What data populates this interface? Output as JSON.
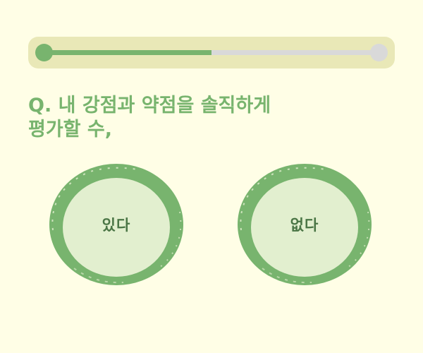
{
  "progress": {
    "fraction": 0.5
  },
  "question": {
    "lines": [
      "Q. 내 강점과 약점을 솔직하게",
      "평가할 수,"
    ]
  },
  "answers": [
    {
      "label": "있다"
    },
    {
      "label": "없다"
    }
  ],
  "colors": {
    "background": "#fffee6",
    "accent": "#78b46e",
    "progress_bar_bg": "#e9e8b7",
    "track": "#d9d9d9",
    "answer_fill": "#e2efcf",
    "answer_text": "#4a7545"
  }
}
